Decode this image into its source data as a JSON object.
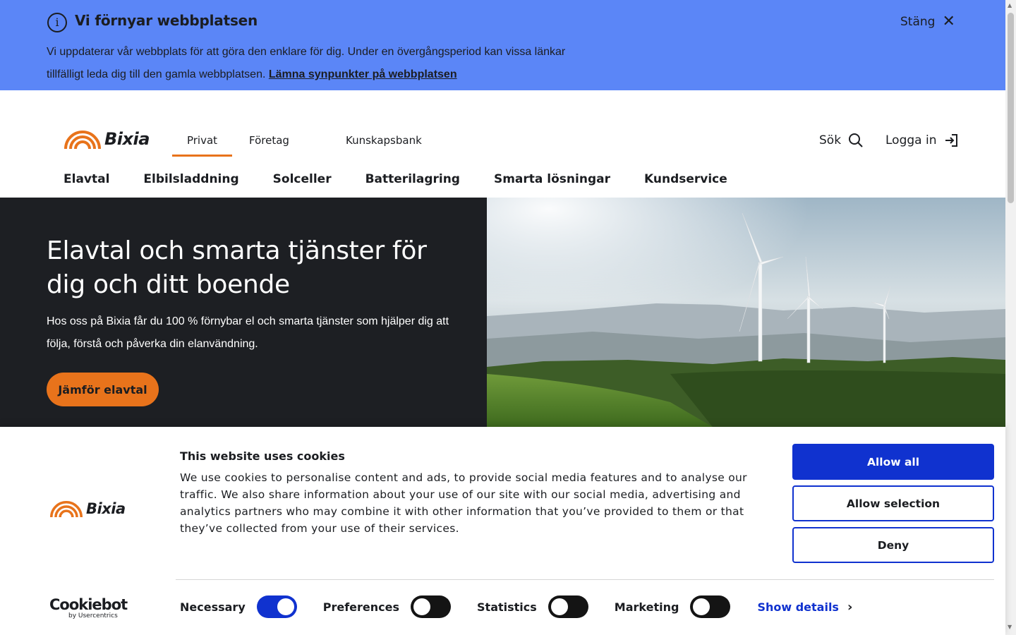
{
  "banner": {
    "title": "Vi förnyar webbplatsen",
    "text": "Vi uppdaterar vår webbplats för att göra den enklare för dig. Under en övergångsperiod kan vissa länkar tillfälligt leda dig till den gamla webbplatsen.",
    "link": "Lämna synpunkter på webbplatsen",
    "close_label": "Stäng",
    "info_glyph": "i",
    "close_glyph": "✕"
  },
  "header": {
    "logo_text": "Bixia",
    "segments": [
      "Privat",
      "Företag",
      "Kunskapsbank"
    ],
    "active_segment": "Privat",
    "search_label": "Sök",
    "login_label": "Logga in"
  },
  "nav": {
    "items": [
      "Elavtal",
      "Elbilsladdning",
      "Solceller",
      "Batterilagring",
      "Smarta lösningar",
      "Kundservice"
    ]
  },
  "hero": {
    "title": "Elavtal och smarta tjänster för dig och ditt boende",
    "text": "Hos oss på Bixia får du 100 % förnybar el och smarta tjänster som hjälper dig att följa, förstå och påverka din elanvändning.",
    "button": "Jämför elavtal"
  },
  "cookie": {
    "logo_text": "Bixia",
    "title": "This website uses cookies",
    "text": "We use cookies to personalise content and ads, to provide social media features and to analyse our traffic. We also share information about your use of our site with our social media, advertising and analytics partners who may combine it with other information that you’ve provided to them or that they’ve collected from your use of their services.",
    "allow_all": "Allow all",
    "allow_selection": "Allow selection",
    "deny": "Deny",
    "brand": "Cookiebot",
    "brand_sub": "by Usercentrics",
    "toggles": [
      {
        "label": "Necessary",
        "on": true
      },
      {
        "label": "Preferences",
        "on": false
      },
      {
        "label": "Statistics",
        "on": false
      },
      {
        "label": "Marketing",
        "on": false
      }
    ],
    "show_details": "Show details",
    "chevron_glyph": "›"
  },
  "colors": {
    "banner_bg": "#5b86f7",
    "brand_orange": "#e8731b",
    "hero_dark": "#1d1f23",
    "cookie_blue": "#1032cf"
  }
}
